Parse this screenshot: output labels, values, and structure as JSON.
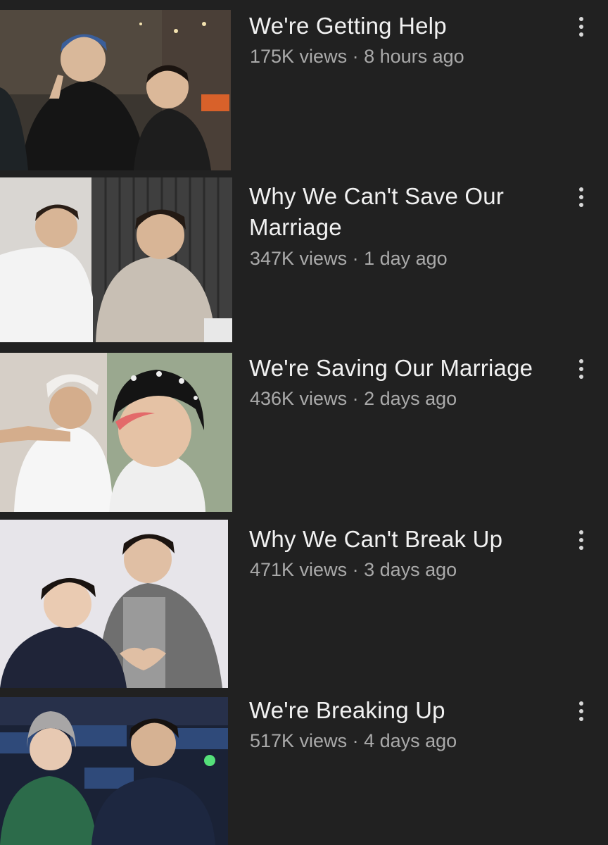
{
  "videos": [
    {
      "title": "We're Getting Help",
      "views": "175K views",
      "age": "8 hours ago"
    },
    {
      "title": "Why We Can't Save Our Marriage",
      "views": "347K views",
      "age": "1 day ago"
    },
    {
      "title": "We're Saving Our Marriage",
      "views": "436K views",
      "age": "2 days ago"
    },
    {
      "title": "Why We Can't Break Up",
      "views": "471K views",
      "age": "3 days ago"
    },
    {
      "title": "We're Breaking Up",
      "views": "517K views",
      "age": "4 days ago"
    }
  ],
  "separator": " · ",
  "icons": {
    "more": "more-vertical-icon"
  },
  "colors": {
    "background": "#212121",
    "title": "#f1f1f1",
    "meta": "#aaaaaa"
  }
}
